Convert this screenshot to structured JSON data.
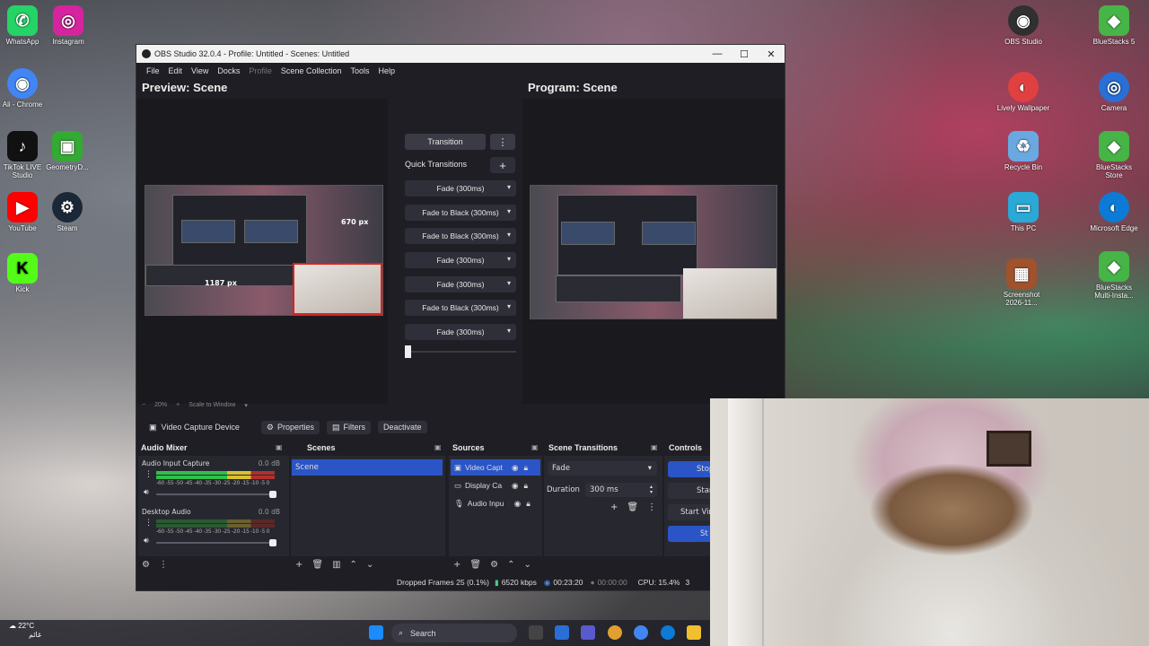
{
  "desktop": {
    "left_icons": [
      {
        "label": "WhatsApp",
        "glyph": "✆",
        "color": "#25d366"
      },
      {
        "label": "Instagram",
        "glyph": "◎",
        "color": "#d6249f"
      },
      {
        "label": "Ali - Chrome",
        "glyph": "◉",
        "color": "#4285f4"
      },
      {
        "label": "TikTok LIVE Studio",
        "glyph": "♪",
        "color": "#111111"
      },
      {
        "label": "GeometryD...",
        "glyph": "▣",
        "color": "#33aa33"
      },
      {
        "label": "YouTube",
        "glyph": "▶",
        "color": "#ff0000"
      },
      {
        "label": "Steam",
        "glyph": "⚙",
        "color": "#1b2838"
      },
      {
        "label": "Kick",
        "glyph": "K",
        "color": "#53fc18"
      }
    ],
    "right_icons": [
      {
        "label": "OBS Studio",
        "glyph": "◉",
        "color": "#303030"
      },
      {
        "label": "BlueStacks 5",
        "glyph": "◆",
        "color": "#46b446"
      },
      {
        "label": "Lively Wallpaper",
        "glyph": "◐",
        "color": "#e04040"
      },
      {
        "label": "Camera",
        "glyph": "◎",
        "color": "#2a6fd6"
      },
      {
        "label": "Recycle Bin",
        "glyph": "♻",
        "color": "#6aa9e0"
      },
      {
        "label": "BlueStacks Store",
        "glyph": "◆",
        "color": "#46b446"
      },
      {
        "label": "This PC",
        "glyph": "▭",
        "color": "#2aa8d6"
      },
      {
        "label": "Microsoft Edge",
        "glyph": "◐",
        "color": "#0c7bd6"
      },
      {
        "label": "Screenshot 2026-11...",
        "glyph": "▦",
        "color": "#a0522d"
      },
      {
        "label": "BlueStacks Multi-Insta...",
        "glyph": "◆",
        "color": "#46b446"
      }
    ]
  },
  "obs": {
    "title": "OBS Studio 32.0.4 - Profile: Untitled - Scenes: Untitled",
    "menu": [
      "File",
      "Edit",
      "View",
      "Docks",
      "Profile",
      "Scene Collection",
      "Tools",
      "Help"
    ],
    "preview_title": "Preview: Scene",
    "program_title": "Program: Scene",
    "preview_overlay_text": "1187 px",
    "preview_overlay_text2": "670 px",
    "transition_button": "Transition",
    "quick_transitions_label": "Quick Transitions",
    "quick_transitions": [
      "Fade (300ms)",
      "Fade to Black (300ms)",
      "Fade to Black (300ms)",
      "Fade (300ms)",
      "Fade (300ms)",
      "Fade to Black (300ms)",
      "Fade (300ms)"
    ],
    "zoom_text": "20%",
    "scale_text": "Scale to Window",
    "context_bar": {
      "source_name": "Video Capture Device",
      "properties": "Properties",
      "filters": "Filters",
      "deactivate": "Deactivate"
    },
    "docks": {
      "audio_mixer": {
        "title": "Audio Mixer",
        "channels": [
          {
            "name": "Audio Input Capture",
            "db": "0.0 dB",
            "level": 0.7
          },
          {
            "name": "Desktop Audio",
            "db": "0.0 dB",
            "level": 0.0
          }
        ],
        "ticks": "-60 -55 -50 -45 -40 -35 -30 -25 -20 -15 -10 -5 0"
      },
      "scenes": {
        "title": "Scenes",
        "items": [
          "Scene"
        ]
      },
      "sources": {
        "title": "Sources",
        "items": [
          "Video Capt",
          "Display Ca",
          "Audio Inpu"
        ]
      },
      "scene_transitions": {
        "title": "Scene Transitions",
        "selected": "Fade",
        "duration_label": "Duration",
        "duration_value": "300 ms"
      },
      "controls": {
        "title": "Controls",
        "buttons": [
          "Stop",
          "Star",
          "Start Virtu",
          "St"
        ]
      }
    },
    "status": {
      "dropped": "Dropped Frames 25 (0.1%)",
      "bitrate": "6520 kbps",
      "live_time": "00:23:20",
      "rec_time": "00:00:00",
      "cpu": "CPU: 15.4%",
      "tail": "3"
    }
  },
  "taskbar": {
    "weather_temp": "22°C",
    "weather_text": "غائم",
    "search_placeholder": "Search"
  },
  "colors": {
    "accent_blue": "#2b55c7",
    "obs_bg": "#1e1e24",
    "dock_bg": "#27282f"
  }
}
